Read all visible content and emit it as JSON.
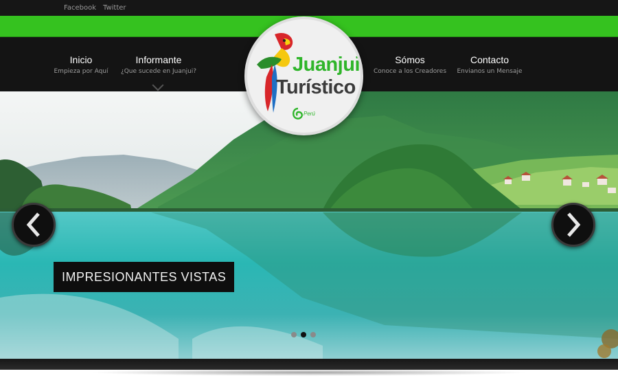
{
  "topbar": {
    "links": [
      {
        "label": "Facebook"
      },
      {
        "label": "Twitter"
      }
    ]
  },
  "nav": {
    "items": [
      {
        "title": "Inicio",
        "subtitle": "Empieza por Aquí"
      },
      {
        "title": "Informante",
        "subtitle": "¿Que sucede en Juanjui?"
      },
      {
        "title": "Sómos",
        "subtitle": "Conoce a los Creadores"
      },
      {
        "title": "Contacto",
        "subtitle": "Envianos un Mensaje"
      }
    ]
  },
  "logo": {
    "line1": "Juanjui",
    "line2": "Turístico",
    "badge": "Perú"
  },
  "slider": {
    "caption": "IMPRESIONANTES VISTAS",
    "slide_count": 3,
    "active_slide": 2
  },
  "colors": {
    "brand_green": "#35c21f",
    "dark": "#141414",
    "lake": "#2ab7b4"
  }
}
